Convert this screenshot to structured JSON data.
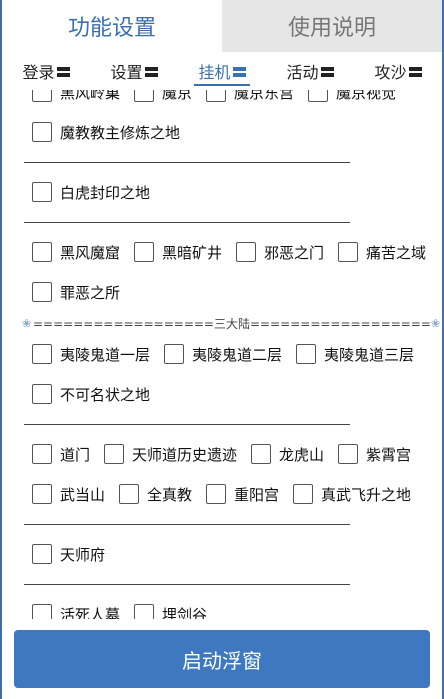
{
  "top_tabs": [
    {
      "label": "功能设置"
    },
    {
      "label": "使用说明"
    }
  ],
  "sub_tabs": [
    {
      "label": "登录"
    },
    {
      "label": "设置"
    },
    {
      "label": "挂机"
    },
    {
      "label": "活动"
    },
    {
      "label": "攻沙"
    }
  ],
  "sections": {
    "partial_row": [
      "黑风岭巢",
      "魔京",
      "魔京东宫",
      "魔京视觉"
    ],
    "mojiao": [
      "魔教教主修炼之地"
    ],
    "baihu": [
      "白虎封印之地"
    ],
    "darks": [
      "黑风魔窟",
      "黑暗矿井",
      "邪恶之门",
      "痛苦之域"
    ],
    "darks2": [
      "罪恶之所"
    ],
    "continent_divider": "==================三大陆==================",
    "yiling": [
      "夷陵鬼道一层",
      "夷陵鬼道二层",
      "夷陵鬼道三层"
    ],
    "yiling2": [
      "不可名状之地"
    ],
    "dao1": [
      "道门",
      "天师道历史遗迹",
      "龙虎山",
      "紫霄宫"
    ],
    "dao2": [
      "武当山",
      "全真教",
      "重阳宫",
      "真武飞升之地"
    ],
    "tianshi": [
      "天师府"
    ],
    "last": [
      "活死人墓",
      "埋剑谷"
    ]
  },
  "start_button": {
    "label": "启动浮窗"
  },
  "colors": {
    "accent": "#3a6fb0",
    "button": "#3d78c0"
  }
}
